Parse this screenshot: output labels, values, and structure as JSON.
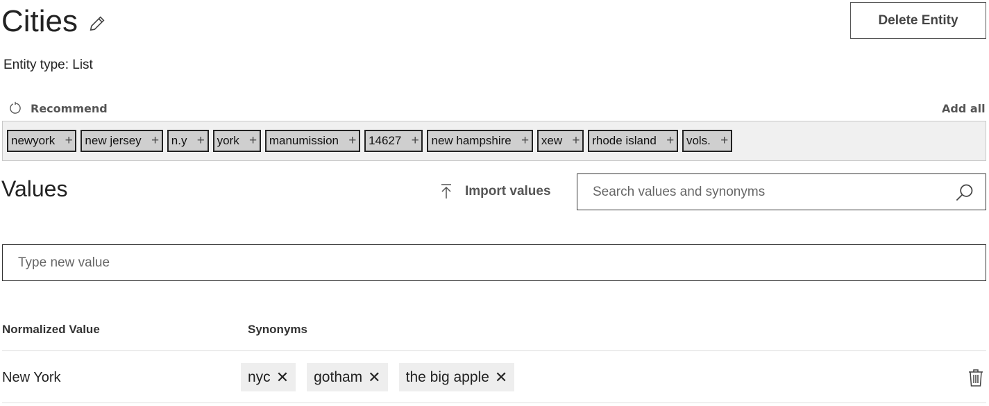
{
  "header": {
    "title": "Cities",
    "delete_label": "Delete Entity",
    "entity_type": "Entity type: List"
  },
  "recommend": {
    "label": "Recommend",
    "add_all": "Add all",
    "chips": [
      "newyork",
      "new jersey",
      "n.y",
      "york",
      "manumission",
      "14627",
      "new hampshire",
      "xew",
      "rhode island",
      "vols."
    ],
    "plus": "+"
  },
  "values": {
    "heading": "Values",
    "import_label": "Import values",
    "search_placeholder": "Search values and synonyms",
    "new_value_placeholder": "Type new value"
  },
  "table": {
    "col_normalized": "Normalized Value",
    "col_synonyms": "Synonyms",
    "rows": [
      {
        "value": "New York",
        "synonyms": [
          "nyc",
          "gotham",
          "the big apple"
        ]
      }
    ]
  },
  "remove_glyph": "✕"
}
